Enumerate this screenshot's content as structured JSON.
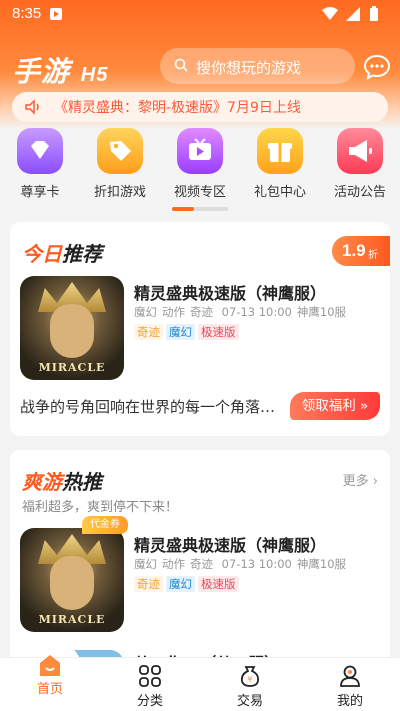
{
  "status_bar": {
    "time": "8:35"
  },
  "header": {
    "logo": "手游",
    "logo_suffix": "H5",
    "search_placeholder": "搜你想玩的游戏"
  },
  "notice": {
    "text": "《精灵盛典：黎明-极速版》7月9日上线"
  },
  "categories": [
    {
      "label": "尊享卡",
      "icon": "diamond-icon",
      "color": "#a66cff"
    },
    {
      "label": "折扣游戏",
      "icon": "tag-icon",
      "color": "#ffb02a"
    },
    {
      "label": "视频专区",
      "icon": "tv-icon",
      "color": "#c05cff"
    },
    {
      "label": "礼包中心",
      "icon": "gift-icon",
      "color": "#ffb52a"
    },
    {
      "label": "活动公告",
      "icon": "megaphone-icon",
      "color": "#ff5a6a"
    }
  ],
  "today": {
    "title_a": "今日",
    "title_b": "推荐",
    "discount_value": "1.9",
    "discount_unit": "折",
    "game": {
      "name": "精灵盛典极速版（神鹰服）",
      "genres": [
        "魔幻",
        "动作",
        "奇迹"
      ],
      "date": "07-13 10:00",
      "server": "神鹰10服",
      "tags": [
        "奇迹",
        "魔幻",
        "极速版"
      ],
      "thumb_brand": "MIRACLE"
    },
    "description": "战争的号角回响在世界的每一个角落…",
    "welfare_button": "领取福利 »"
  },
  "hot": {
    "title_a": "爽游",
    "title_b": "热推",
    "more": "更多 ›",
    "subtitle": "福利超多，爽到停不下来！",
    "voucher_badge": "代金券",
    "game": {
      "name": "精灵盛典极速版（神鹰服）",
      "genres": [
        "魔幻",
        "动作",
        "奇迹"
      ],
      "date": "07-13 10:00",
      "server": "神鹰10服",
      "tags": [
        "奇迹",
        "魔幻",
        "极速版"
      ],
      "thumb_brand": "MIRACLE"
    },
    "next_partial": "从工作...（从工服）"
  },
  "bottom_nav": [
    {
      "label": "首页",
      "icon": "home-icon",
      "active": true
    },
    {
      "label": "分类",
      "icon": "category-icon",
      "active": false
    },
    {
      "label": "交易",
      "icon": "trade-icon",
      "active": false
    },
    {
      "label": "我的",
      "icon": "profile-icon",
      "active": false
    }
  ]
}
